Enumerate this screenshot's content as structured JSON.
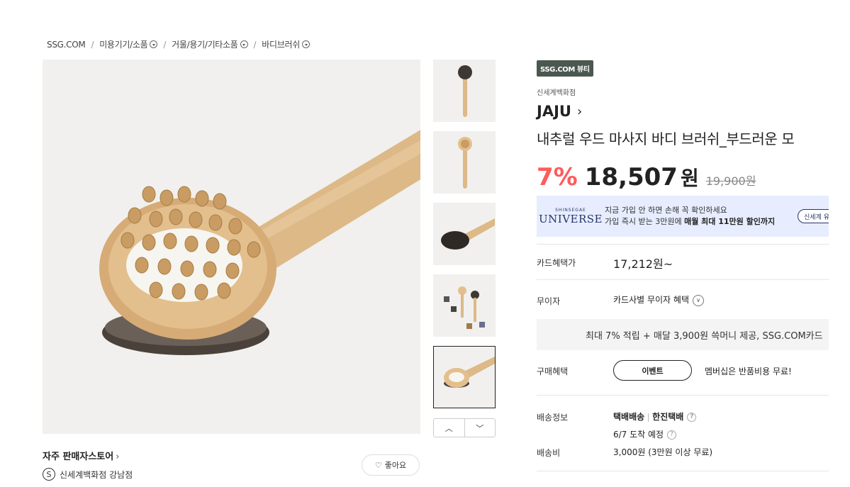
{
  "breadcrumb": {
    "home": "SSG.COM",
    "cat1": "미용기기/소품",
    "cat2": "거울/용기/기타소품",
    "cat3": "바디브러쉬"
  },
  "gallery": {
    "thumb_prev": "︿",
    "thumb_next": "﹀"
  },
  "store": {
    "name": "자주 판매자스토어",
    "badge": "S",
    "branch": "신세계백화점 강남점",
    "like_label": "좋아요"
  },
  "product": {
    "channel_badge": "SSG.COM 뷰티",
    "department": "신세계백화점",
    "brand": "JAJU",
    "title": "내추럴 우드 마사지 바디 브러쉬_부드러운 모",
    "discount": "7%",
    "price": "18,507",
    "price_unit": "원",
    "original_price": "19,900원"
  },
  "universe": {
    "logo_small": "SHINSEGAE",
    "logo_big": "UNIVERSE",
    "line1": "지금 가입 안 하면 손해 꼭 확인하세요",
    "line2_prefix": "가입 즉시 받는 3만원에 ",
    "line2_bold": "매월 최대 11만원 할인까지",
    "button": "신세계 유니버스"
  },
  "info": {
    "card_label": "카드혜택가",
    "card_value": "17,212원~",
    "installment_label": "무이자",
    "installment_value": "카드사별 무이자 혜택",
    "promo": "최대 7% 적립 + 매달 3,900원 쓱머니 제공, SSG.COM카드",
    "purchase_label": "구매혜택",
    "event_button": "이벤트",
    "membership_text": "멤버십은 반품비용 무료!",
    "shipping_label": "배송정보",
    "ship_method": "택배배송",
    "ship_carrier": "한진택배",
    "arrival": "6/7 도착 예정",
    "fee_label": "배송비",
    "fee_value": "3,000원 (3만원 이상 무료)"
  },
  "colors": {
    "discount": "#ff5b59",
    "badge_bg": "#4a5850",
    "universe_bg": "#e7edff",
    "universe_text": "#26356b"
  }
}
